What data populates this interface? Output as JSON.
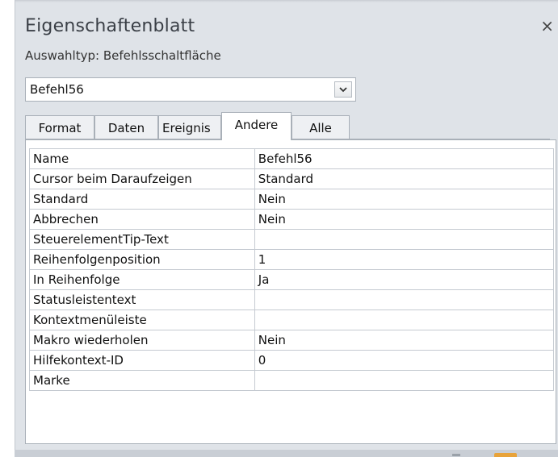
{
  "window": {
    "title": "Eigenschaftenblatt",
    "close_glyph": "×",
    "close_icon": "close-icon"
  },
  "selection": {
    "type_label": "Auswahltyp:  Befehlsschaltfläche",
    "object_value": "Befehl56",
    "dropdown_icon": "chevron-down-icon"
  },
  "tabs": [
    {
      "label": "Format",
      "active": false
    },
    {
      "label": "Daten",
      "active": false
    },
    {
      "label": "Ereignis",
      "active": false
    },
    {
      "label": "Andere",
      "active": true
    },
    {
      "label": "Alle",
      "active": false
    }
  ],
  "properties": [
    {
      "name": "Name",
      "value": "Befehl56"
    },
    {
      "name": "Cursor beim Daraufzeigen",
      "value": "Standard"
    },
    {
      "name": "Standard",
      "value": "Nein"
    },
    {
      "name": "Abbrechen",
      "value": "Nein"
    },
    {
      "name": "SteuerelementTip-Text",
      "value": ""
    },
    {
      "name": "Reihenfolgenposition",
      "value": "1"
    },
    {
      "name": "In Reihenfolge",
      "value": "Ja"
    },
    {
      "name": "Statusleistentext",
      "value": ""
    },
    {
      "name": "Kontextmenüleiste",
      "value": ""
    },
    {
      "name": "Makro wiederholen",
      "value": "Nein"
    },
    {
      "name": "Hilfekontext-ID",
      "value": "0"
    },
    {
      "name": "Marke",
      "value": ""
    }
  ],
  "colors": {
    "panel_bg": "#dfe3e8",
    "grid_border": "#c5cad1",
    "frame_border": "#a9b0b8"
  }
}
